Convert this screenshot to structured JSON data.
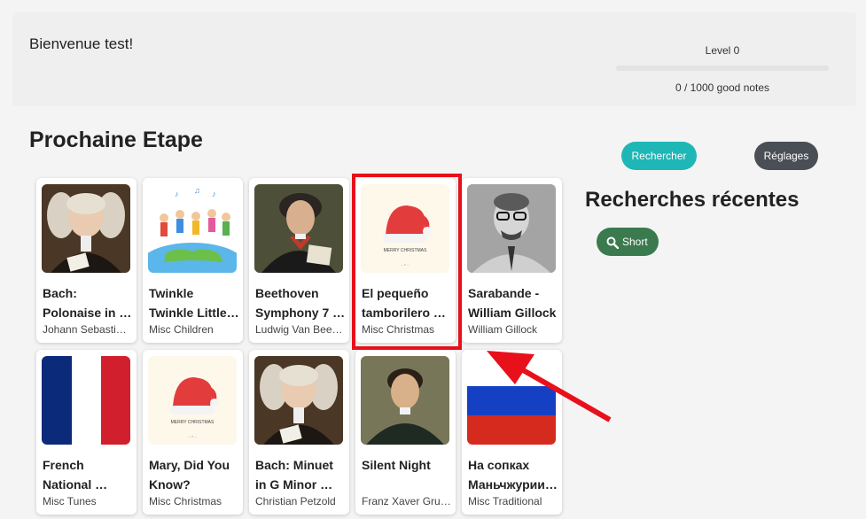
{
  "header": {
    "welcome": "Bienvenue test!",
    "level_label": "Level 0",
    "progress": 0.0,
    "notes_label": "0 / 1000 good notes"
  },
  "main": {
    "section_title": "Prochaine Etape"
  },
  "cards": [
    {
      "title": "Bach: Polonaise in …",
      "subtitle": "Johann Sebasti…",
      "image": "bach-portrait"
    },
    {
      "title": "Twinkle Twinkle Little…",
      "subtitle": "Misc Children",
      "image": "children-globe"
    },
    {
      "title": "Beethoven Symphony 7 …",
      "subtitle": "Ludwig Van Bee…",
      "image": "beethoven-portrait"
    },
    {
      "title": "El pequeño tamborilero …",
      "subtitle": "Misc Christmas",
      "image": "santa-hat"
    },
    {
      "title": "Sarabande - William Gillock",
      "subtitle": "William Gillock",
      "image": "gillock-photo"
    },
    {
      "title": "French National …",
      "subtitle": "Misc Tunes",
      "image": "french-flag"
    },
    {
      "title": "Mary, Did You Know?",
      "subtitle": "Misc Christmas",
      "image": "santa-hat"
    },
    {
      "title": "Bach: Minuet in G Minor …",
      "subtitle": "Christian Petzold",
      "image": "bach-portrait"
    },
    {
      "title": "Silent Night",
      "subtitle": "Franz Xaver Gru…",
      "image": "gruber-portrait"
    },
    {
      "title": "На сопках Маньчжурии…",
      "subtitle": "Misc Traditional",
      "image": "russian-flag"
    }
  ],
  "sidebar": {
    "search_label": "Rechercher",
    "settings_label": "Réglages",
    "recent_title": "Recherches récentes",
    "recent_chip": "Short",
    "chip_icon": "search-icon"
  },
  "colors": {
    "accent": "#1fb6b6",
    "settings": "#4a4e55",
    "chip": "#3a7a4e",
    "highlight": "#e8101a"
  }
}
